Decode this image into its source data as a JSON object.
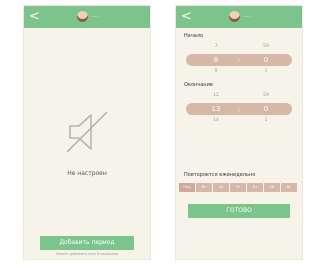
{
  "left_screen": {
    "header": {
      "back": "<",
      "name": "·······"
    },
    "empty_text": "Не настроен",
    "add_button": "Добавить период",
    "hint": {
      "prefix": "Может добавить еще",
      "count": "5",
      "suffix": "периодов"
    }
  },
  "right_screen": {
    "header": {
      "back": "<",
      "name": "·······"
    },
    "start": {
      "label": "Начало",
      "prev": {
        "hour": "7",
        "minute": "59"
      },
      "selected": {
        "hour": "8",
        "minute": "0"
      },
      "next": {
        "hour": "9",
        "minute": "1"
      }
    },
    "end": {
      "label": "Окончание",
      "prev": {
        "hour": "12",
        "minute": "59"
      },
      "selected": {
        "hour": "13",
        "minute": "0"
      },
      "next": {
        "hour": "14",
        "minute": "1"
      }
    },
    "separator": ":",
    "repeat_label": "Повторяется еженедельно",
    "days": [
      "Пнд",
      "Вт",
      "Ср",
      "Чт",
      "Пт",
      "Сб",
      "Вс"
    ],
    "done_button": "ГОТОВО"
  },
  "colors": {
    "accent": "#7cc48b",
    "picker": "#d7b7a8",
    "background": "#f6f4e9"
  },
  "icons": {
    "empty_state": "speaker-muted-icon",
    "back": "chevron-left-icon"
  }
}
